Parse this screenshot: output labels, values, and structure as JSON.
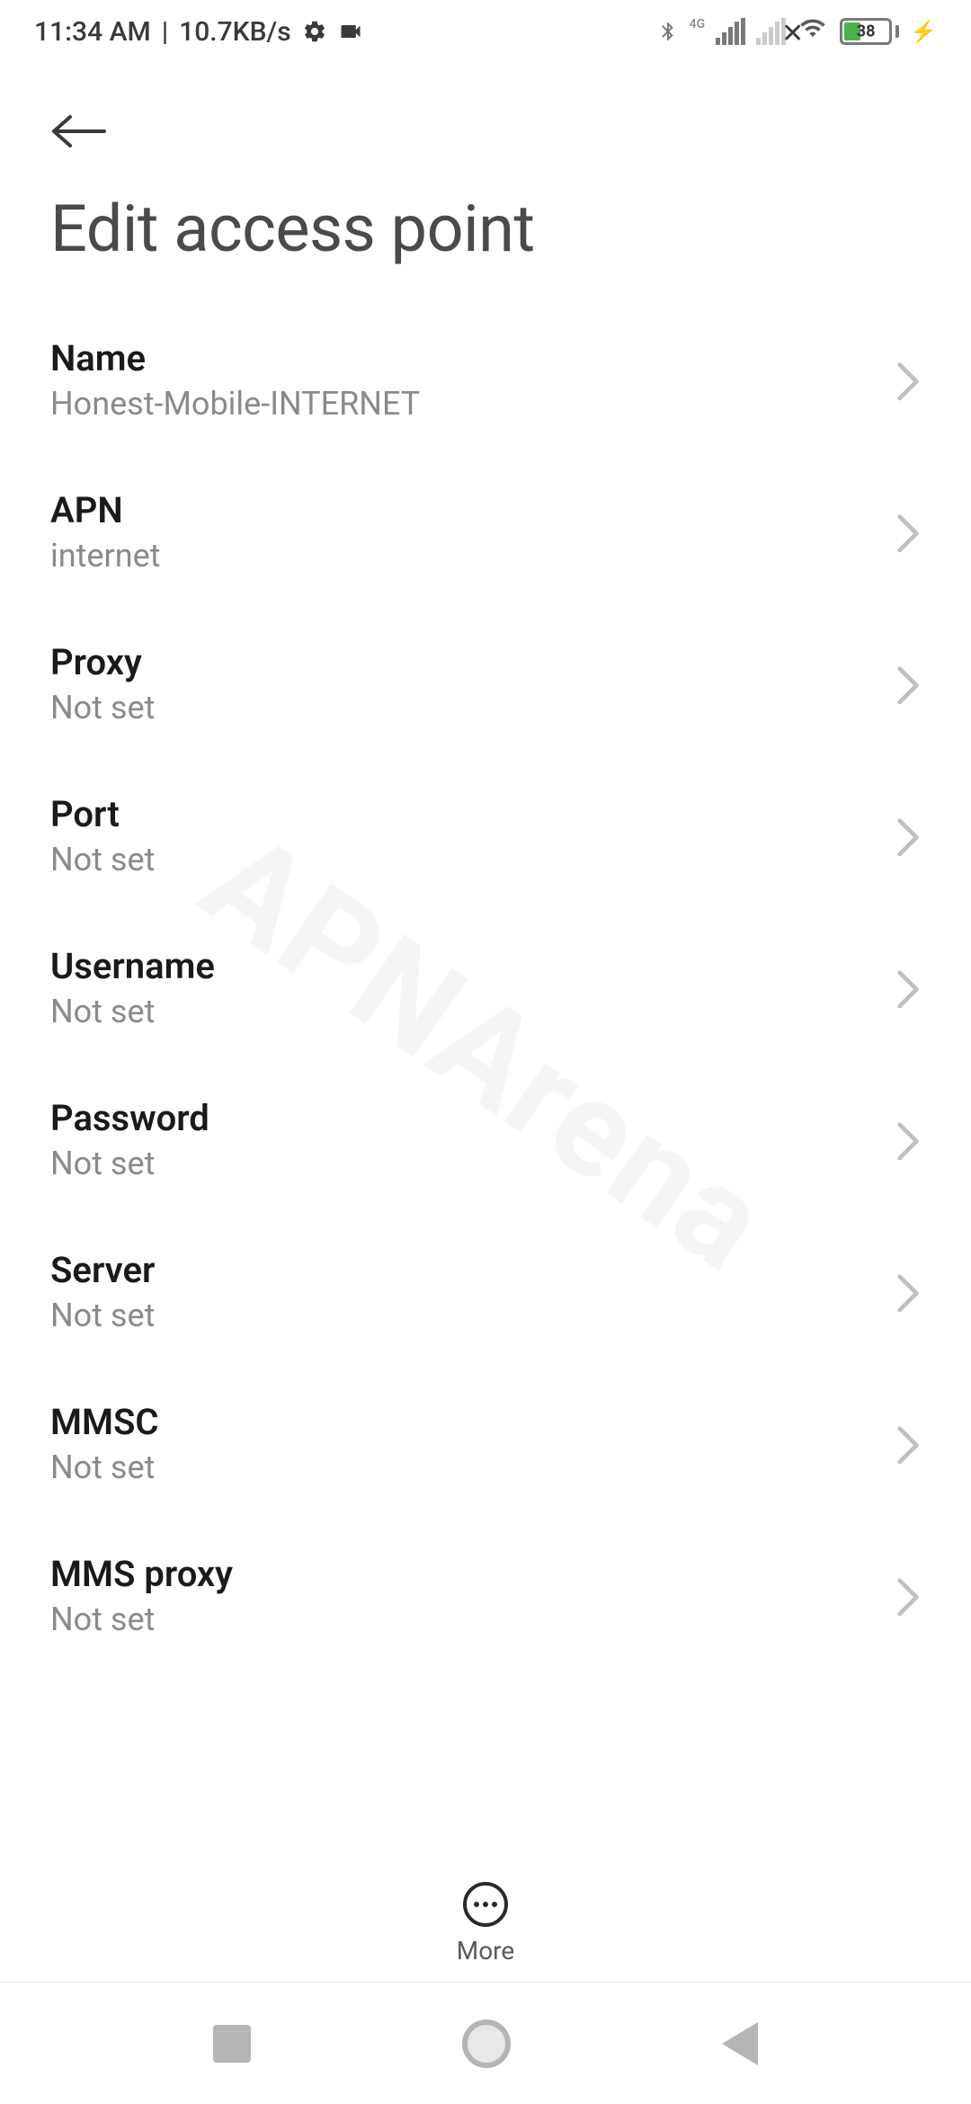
{
  "status_bar": {
    "time": "11:34 AM",
    "separator": " | ",
    "data_rate": "10.7KB/s",
    "network_label": "4G",
    "battery_percent": "38"
  },
  "header": {
    "page_title": "Edit access point"
  },
  "settings": [
    {
      "label": "Name",
      "value": "Honest-Mobile-INTERNET"
    },
    {
      "label": "APN",
      "value": "internet"
    },
    {
      "label": "Proxy",
      "value": "Not set"
    },
    {
      "label": "Port",
      "value": "Not set"
    },
    {
      "label": "Username",
      "value": "Not set"
    },
    {
      "label": "Password",
      "value": "Not set"
    },
    {
      "label": "Server",
      "value": "Not set"
    },
    {
      "label": "MMSC",
      "value": "Not set"
    },
    {
      "label": "MMS proxy",
      "value": "Not set"
    }
  ],
  "bottom_toolbar": {
    "more_label": "More"
  },
  "watermark": "APNArena"
}
